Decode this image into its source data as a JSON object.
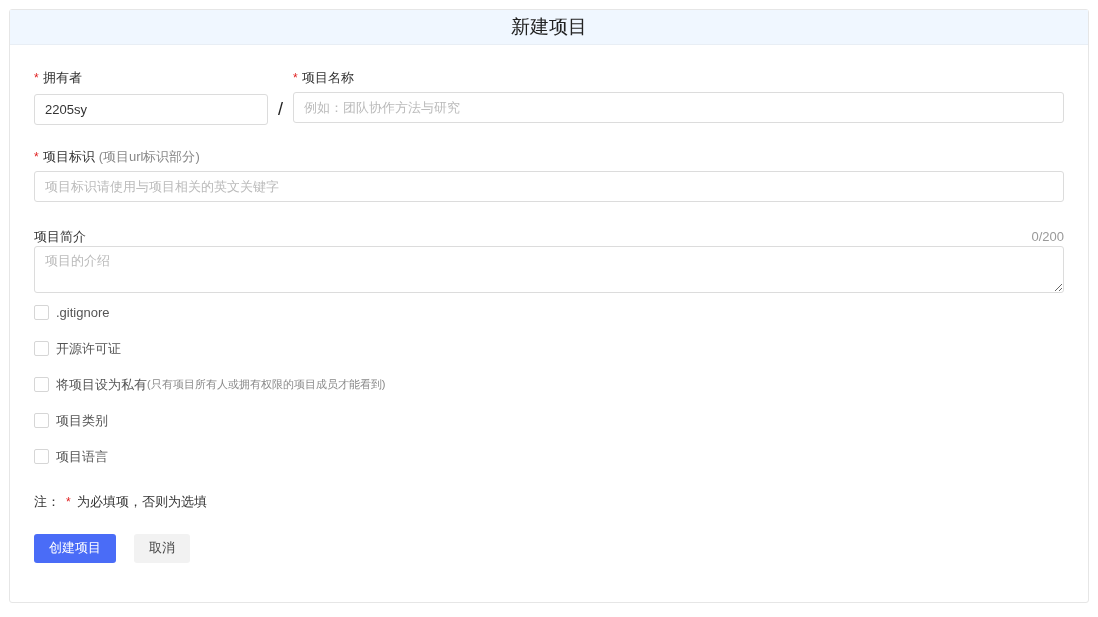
{
  "title": "新建项目",
  "owner": {
    "mark": "*",
    "label": "拥有者",
    "value": "2205sy"
  },
  "separator": "/",
  "name": {
    "mark": "*",
    "label": "项目名称",
    "placeholder": "例如：团队协作方法与研究"
  },
  "identifier": {
    "mark": "*",
    "label": "项目标识",
    "hint": "(项目url标识部分)",
    "placeholder": "项目标识请使用与项目相关的英文关键字"
  },
  "description": {
    "label": "项目简介",
    "counter": "0/200",
    "placeholder": "项目的介绍"
  },
  "options": [
    {
      "label": ".gitignore",
      "checked": false
    },
    {
      "label": "开源许可证",
      "checked": false
    },
    {
      "label": "将项目设为私有",
      "note": "(只有项目所有人或拥有权限的项目成员才能看到)",
      "checked": false
    },
    {
      "label": "项目类别",
      "checked": false
    },
    {
      "label": "项目语言",
      "checked": false
    }
  ],
  "note": {
    "prefix": "注：",
    "mark": "*",
    "text": "为必填项，否则为选填"
  },
  "buttons": [
    {
      "label": "创建项目",
      "kind": "primary"
    },
    {
      "label": "取消",
      "kind": "secondary"
    }
  ]
}
